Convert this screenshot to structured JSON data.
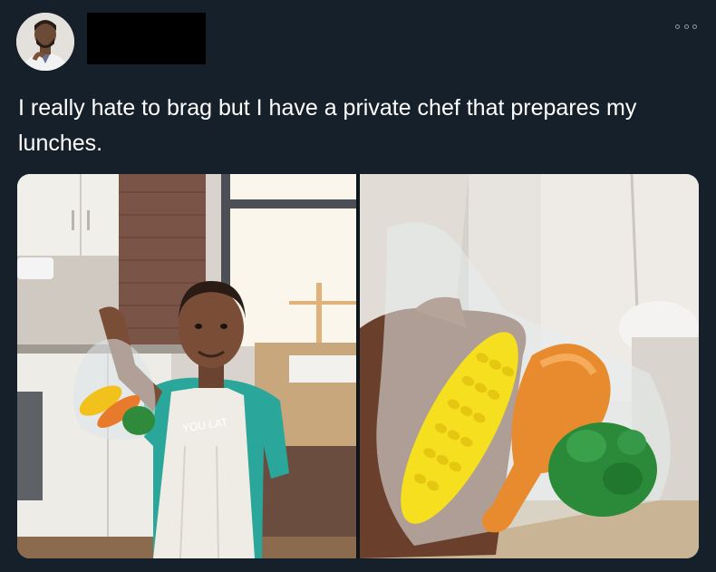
{
  "tweet": {
    "text": "I really hate to brag but I have a private chef that prepares my lunches.",
    "more_icon": "more-horizontal-icon"
  },
  "photo_left": {
    "apron_text": "YOU LAT"
  },
  "colors": {
    "background": "#15202b",
    "text": "#ffffff",
    "icon": "#8899a6"
  }
}
